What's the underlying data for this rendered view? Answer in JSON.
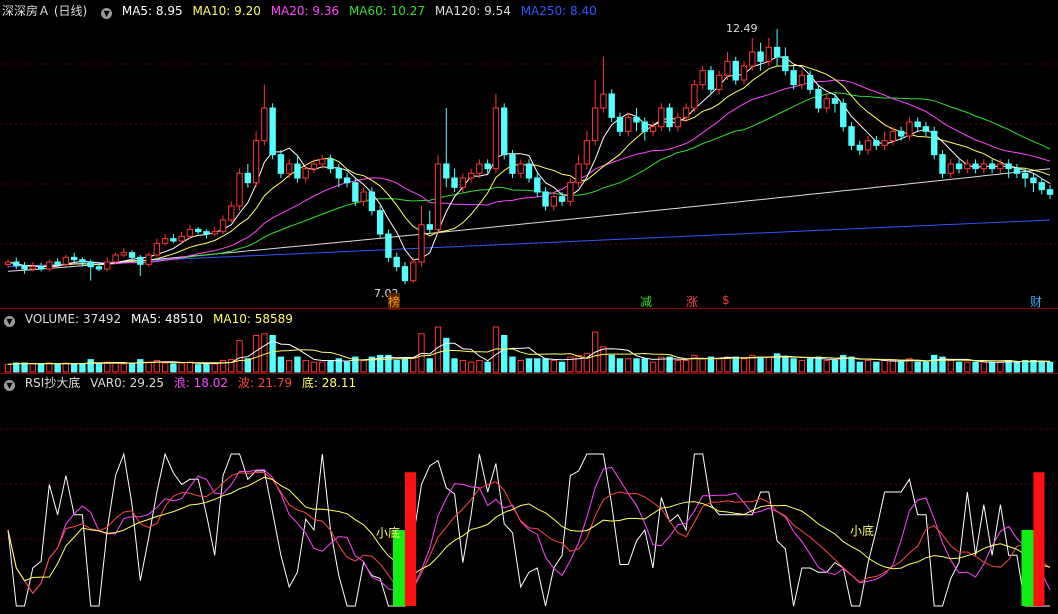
{
  "main": {
    "title": "深深房Ａ (日线)",
    "ma": [
      {
        "label": "MA5: 8.95",
        "color": "#ffffff"
      },
      {
        "label": "MA10: 9.20",
        "color": "#ffff66"
      },
      {
        "label": "MA20: 9.36",
        "color": "#ff44ff"
      },
      {
        "label": "MA60: 10.27",
        "color": "#33dd33"
      },
      {
        "label": "MA120: 9.54",
        "color": "#dddddd"
      },
      {
        "label": "MA250: 8.40",
        "color": "#3355ff"
      }
    ],
    "high_label": "12.49",
    "low_label": "7.02",
    "markers": [
      {
        "text": "榜",
        "color": "#ff9900"
      },
      {
        "text": "减",
        "color": "#33dd33"
      },
      {
        "text": "涨",
        "color": "#ff4444"
      },
      {
        "text": "$",
        "color": "#ff3333"
      },
      {
        "text": "财",
        "color": "#33aaff"
      }
    ]
  },
  "volume": {
    "labels": [
      {
        "label": "VOLUME: 37492",
        "color": "#dddddd"
      },
      {
        "label": "MA5: 48510",
        "color": "#ffffff"
      },
      {
        "label": "MA10: 58589",
        "color": "#ffff66"
      }
    ]
  },
  "indicator": {
    "name": "RSI抄大底",
    "labels": [
      {
        "label": "VAR0: 29.25",
        "color": "#dddddd"
      },
      {
        "label": "浪: 18.02",
        "color": "#ff44ff"
      },
      {
        "label": "波: 21.79",
        "color": "#ff4444"
      },
      {
        "label": "底: 28.11",
        "color": "#ffff66"
      }
    ],
    "signal_label": "小底"
  },
  "chart_data": [
    {
      "type": "candlestick",
      "name": "深深房Ａ 日线",
      "high": 12.49,
      "low": 7.02,
      "ma_latest": {
        "MA5": 8.95,
        "MA10": 9.2,
        "MA20": 9.36,
        "MA60": 10.27,
        "MA120": 9.54,
        "MA250": 8.4
      },
      "candles": [
        [
          7.45,
          7.5,
          7.38,
          7.55
        ],
        [
          7.5,
          7.42,
          7.35,
          7.6
        ],
        [
          7.42,
          7.35,
          7.25,
          7.5
        ],
        [
          7.35,
          7.4,
          7.3,
          7.5
        ],
        [
          7.4,
          7.35,
          7.3,
          7.48
        ],
        [
          7.35,
          7.5,
          7.3,
          7.55
        ],
        [
          7.5,
          7.45,
          7.4,
          7.58
        ],
        [
          7.45,
          7.6,
          7.4,
          7.65
        ],
        [
          7.6,
          7.55,
          7.5,
          7.7
        ],
        [
          7.55,
          7.5,
          7.4,
          7.6
        ],
        [
          7.5,
          7.4,
          7.1,
          7.55
        ],
        [
          7.4,
          7.35,
          7.3,
          7.5
        ],
        [
          7.35,
          7.5,
          7.3,
          7.6
        ],
        [
          7.5,
          7.65,
          7.45,
          7.7
        ],
        [
          7.65,
          7.7,
          7.6,
          7.8
        ],
        [
          7.7,
          7.6,
          7.55,
          7.75
        ],
        [
          7.6,
          7.45,
          7.2,
          7.65
        ],
        [
          7.45,
          7.65,
          7.4,
          7.7
        ],
        [
          7.65,
          7.9,
          7.6,
          8.0
        ],
        [
          7.9,
          8.0,
          7.85,
          8.1
        ],
        [
          8.0,
          7.95,
          7.9,
          8.1
        ],
        [
          7.95,
          8.05,
          7.9,
          8.15
        ],
        [
          8.05,
          8.2,
          8.0,
          8.3
        ],
        [
          8.2,
          8.15,
          8.1,
          8.25
        ],
        [
          8.15,
          8.1,
          8.0,
          8.2
        ],
        [
          8.1,
          8.15,
          8.05,
          8.25
        ],
        [
          8.15,
          8.4,
          8.1,
          8.5
        ],
        [
          8.4,
          8.7,
          8.35,
          8.8
        ],
        [
          8.7,
          9.4,
          8.6,
          9.5
        ],
        [
          9.4,
          9.2,
          9.1,
          9.6
        ],
        [
          9.2,
          10.1,
          9.1,
          10.3
        ],
        [
          10.1,
          10.8,
          10.0,
          11.3
        ],
        [
          10.8,
          9.8,
          9.7,
          10.9
        ],
        [
          9.8,
          9.4,
          9.3,
          9.9
        ],
        [
          9.4,
          9.6,
          9.3,
          9.7
        ],
        [
          9.6,
          9.3,
          9.2,
          9.8
        ],
        [
          9.3,
          9.5,
          9.2,
          9.6
        ],
        [
          9.5,
          9.6,
          9.4,
          9.7
        ],
        [
          9.6,
          9.7,
          9.5,
          9.8
        ],
        [
          9.7,
          9.5,
          9.4,
          9.8
        ],
        [
          9.5,
          9.3,
          9.1,
          9.6
        ],
        [
          9.3,
          9.2,
          9.1,
          9.4
        ],
        [
          9.2,
          8.8,
          8.7,
          9.3
        ],
        [
          8.8,
          9.0,
          8.7,
          9.1
        ],
        [
          9.0,
          8.6,
          8.5,
          9.1
        ],
        [
          8.6,
          8.1,
          8.0,
          8.7
        ],
        [
          8.1,
          7.6,
          7.5,
          8.2
        ],
        [
          7.6,
          7.4,
          7.3,
          7.7
        ],
        [
          7.4,
          7.1,
          7.02,
          7.5
        ],
        [
          7.1,
          7.5,
          7.05,
          7.6
        ],
        [
          7.5,
          8.3,
          7.4,
          8.7
        ],
        [
          8.3,
          8.2,
          8.1,
          8.6
        ],
        [
          8.2,
          9.6,
          8.1,
          9.8
        ],
        [
          9.6,
          9.3,
          9.1,
          10.8
        ],
        [
          9.3,
          9.1,
          9.0,
          9.5
        ],
        [
          9.1,
          9.3,
          9.0,
          9.4
        ],
        [
          9.3,
          9.4,
          9.2,
          9.5
        ],
        [
          9.4,
          9.6,
          9.3,
          9.7
        ],
        [
          9.6,
          9.5,
          9.4,
          9.7
        ],
        [
          9.5,
          10.8,
          9.4,
          11.1
        ],
        [
          10.8,
          9.8,
          9.7,
          10.9
        ],
        [
          9.8,
          9.4,
          9.3,
          9.9
        ],
        [
          9.4,
          9.6,
          9.3,
          9.7
        ],
        [
          9.6,
          9.3,
          9.2,
          9.7
        ],
        [
          9.3,
          9.0,
          8.9,
          9.4
        ],
        [
          9.0,
          8.7,
          8.6,
          9.1
        ],
        [
          8.7,
          8.9,
          8.6,
          9.0
        ],
        [
          8.9,
          8.8,
          8.7,
          9.0
        ],
        [
          8.8,
          9.2,
          8.7,
          9.3
        ],
        [
          9.2,
          9.6,
          9.1,
          9.8
        ],
        [
          9.6,
          10.1,
          9.5,
          10.3
        ],
        [
          10.1,
          10.8,
          10.0,
          11.4
        ],
        [
          10.8,
          11.1,
          10.7,
          11.9
        ],
        [
          11.1,
          10.6,
          10.5,
          11.2
        ],
        [
          10.6,
          10.3,
          10.2,
          10.7
        ],
        [
          10.3,
          10.6,
          10.2,
          10.7
        ],
        [
          10.6,
          10.5,
          10.3,
          10.8
        ],
        [
          10.5,
          10.3,
          10.1,
          10.6
        ],
        [
          10.3,
          10.4,
          10.2,
          10.5
        ],
        [
          10.4,
          10.8,
          10.3,
          10.9
        ],
        [
          10.8,
          10.4,
          10.3,
          10.9
        ],
        [
          10.4,
          10.6,
          10.3,
          10.7
        ],
        [
          10.6,
          10.8,
          10.5,
          10.9
        ],
        [
          10.8,
          11.3,
          10.7,
          11.4
        ],
        [
          11.3,
          11.6,
          11.2,
          11.7
        ],
        [
          11.6,
          11.2,
          11.1,
          11.7
        ],
        [
          11.2,
          11.5,
          11.1,
          11.6
        ],
        [
          11.5,
          11.8,
          11.4,
          12.0
        ],
        [
          11.8,
          11.4,
          11.3,
          11.9
        ],
        [
          11.4,
          11.7,
          11.3,
          11.8
        ],
        [
          11.7,
          12.0,
          11.6,
          12.3
        ],
        [
          12.0,
          11.8,
          11.6,
          12.2
        ],
        [
          11.8,
          12.1,
          11.7,
          12.3
        ],
        [
          12.1,
          11.9,
          11.7,
          12.49
        ],
        [
          11.9,
          11.6,
          11.5,
          12.1
        ],
        [
          11.6,
          11.3,
          11.2,
          11.7
        ],
        [
          11.3,
          11.5,
          11.2,
          11.6
        ],
        [
          11.5,
          11.2,
          11.1,
          11.6
        ],
        [
          11.2,
          10.8,
          10.7,
          11.3
        ],
        [
          10.8,
          11.0,
          10.7,
          11.1
        ],
        [
          11.0,
          10.9,
          10.7,
          11.1
        ],
        [
          10.9,
          10.4,
          10.3,
          11.0
        ],
        [
          10.4,
          10.0,
          9.9,
          10.5
        ],
        [
          10.0,
          9.9,
          9.8,
          10.1
        ],
        [
          9.9,
          10.1,
          9.8,
          10.2
        ],
        [
          10.1,
          10.0,
          9.9,
          10.2
        ],
        [
          10.0,
          10.1,
          9.9,
          10.3
        ],
        [
          10.1,
          10.3,
          10.0,
          10.4
        ],
        [
          10.3,
          10.2,
          10.1,
          10.4
        ],
        [
          10.2,
          10.5,
          10.1,
          10.6
        ],
        [
          10.5,
          10.4,
          10.3,
          10.6
        ],
        [
          10.4,
          10.3,
          10.2,
          10.5
        ],
        [
          10.3,
          9.8,
          9.7,
          10.4
        ],
        [
          9.8,
          9.4,
          9.3,
          9.9
        ],
        [
          9.4,
          9.6,
          9.3,
          9.7
        ],
        [
          9.6,
          9.5,
          9.4,
          9.7
        ],
        [
          9.5,
          9.6,
          9.4,
          9.7
        ],
        [
          9.6,
          9.5,
          9.4,
          9.7
        ],
        [
          9.5,
          9.6,
          9.4,
          9.7
        ],
        [
          9.6,
          9.5,
          9.4,
          9.7
        ],
        [
          9.5,
          9.6,
          9.4,
          9.7
        ],
        [
          9.6,
          9.5,
          9.3,
          9.7
        ],
        [
          9.5,
          9.4,
          9.3,
          9.6
        ],
        [
          9.4,
          9.3,
          9.1,
          9.5
        ],
        [
          9.3,
          9.2,
          9.0,
          9.4
        ],
        [
          9.2,
          9.05,
          8.95,
          9.3
        ],
        [
          9.05,
          8.95,
          8.85,
          9.15
        ]
      ]
    }
  ]
}
